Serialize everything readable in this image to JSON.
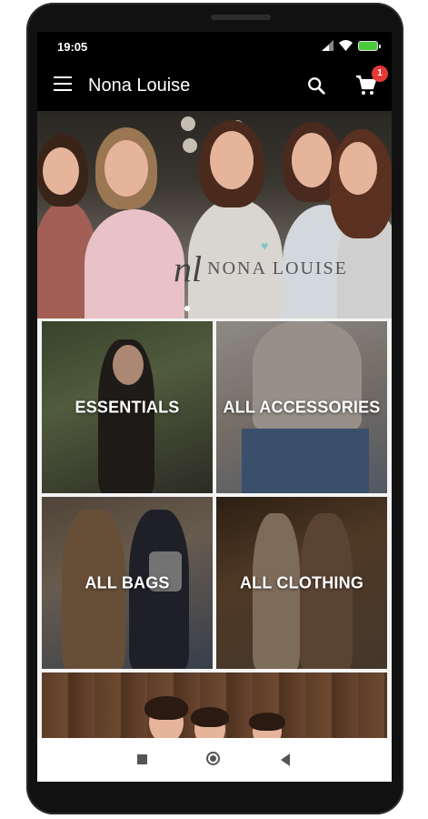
{
  "status_bar": {
    "time": "19:05"
  },
  "toolbar": {
    "title": "Nona Louise",
    "cart_count": "1"
  },
  "hero": {
    "logo_text": "NONA LOUISE",
    "logo_mark": "nl"
  },
  "categories": [
    {
      "label": "ESSENTIALS"
    },
    {
      "label": "ALL ACCESSORIES"
    },
    {
      "label": "ALL BAGS"
    },
    {
      "label": "ALL CLOTHING"
    }
  ],
  "colors": {
    "toolbar": "#000000",
    "badge": "#e53935",
    "battery": "#49c93c"
  }
}
